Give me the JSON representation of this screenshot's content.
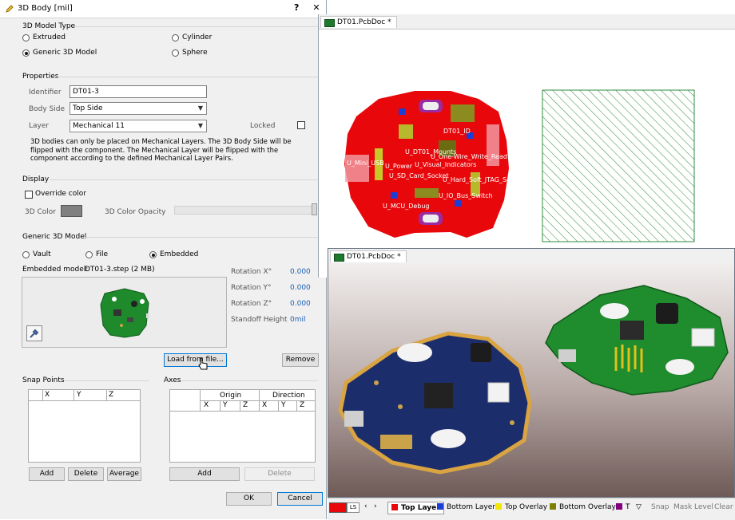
{
  "dialog": {
    "title": "3D Body [mil]",
    "help_label": "?",
    "close_label": "✕",
    "model_type": {
      "heading": "3D Model Type",
      "options": [
        "Extruded",
        "Cylinder",
        "Generic 3D Model",
        "Sphere"
      ],
      "selected": "Generic 3D Model"
    },
    "properties": {
      "heading": "Properties",
      "identifier_label": "Identifier",
      "identifier_value": "DT01-3",
      "body_side_label": "Body Side",
      "body_side_value": "Top Side",
      "layer_label": "Layer",
      "layer_value": "Mechanical 11",
      "locked_label": "Locked",
      "note": "3D bodies can only be placed on Mechanical Layers. The 3D Body Side will be flipped with the component. The Mechanical Layer will be flipped with the component according to the defined Mechanical Layer Pairs."
    },
    "display": {
      "heading": "Display",
      "override_label": "Override color",
      "color_label": "3D Color",
      "color_value": "#808080",
      "opacity_label": "3D Color Opacity"
    },
    "generic": {
      "heading": "Generic 3D Model",
      "source_options": [
        "Vault",
        "File",
        "Embedded"
      ],
      "source_selected": "Embedded",
      "embedded_label": "Embedded model:",
      "embedded_value": "DT01-3.step (2 MB)",
      "rot_x_label": "Rotation X°",
      "rot_x_value": "0.000",
      "rot_y_label": "Rotation Y°",
      "rot_y_value": "0.000",
      "rot_z_label": "Rotation Z°",
      "rot_z_value": "0.000",
      "standoff_label": "Standoff Height",
      "standoff_value": "0mil",
      "load_button": "Load from file...",
      "remove_button": "Remove"
    },
    "snap_points": {
      "heading": "Snap Points",
      "columns": [
        "X",
        "Y",
        "Z"
      ],
      "add_button": "Add",
      "delete_button": "Delete",
      "average_button": "Average"
    },
    "axes": {
      "heading": "Axes",
      "group_origin": "Origin",
      "group_direction": "Direction",
      "columns": [
        "X",
        "Y",
        "Z",
        "X",
        "Y",
        "Z"
      ],
      "add_button": "Add",
      "delete_button": "Delete"
    },
    "ok_button": "OK",
    "cancel_button": "Cancel"
  },
  "pcb2d": {
    "tab_label": "DT01.PcbDoc *",
    "board_color": "#e8080c",
    "hatch_color": "#2e8b3e",
    "labels": [
      "DT01_ID",
      "U_DT01_Mounts",
      "U_One-Wire_Write_Read",
      "U_Mini_USB",
      "U_Power",
      "U_Visual_Indicators",
      "U_SD_Card_Socket",
      "U_Hard_Soft_JTAG_Socket",
      "U_IO_Bus_Switch",
      "U_MCU_Debug"
    ]
  },
  "pcb3d": {
    "tab_label": "DT01.PcbDoc *"
  },
  "status_bar": {
    "current_color": "#e8080c",
    "ls_label": "LS",
    "layers": [
      {
        "name": "Top Layer",
        "color": "#e8080c"
      },
      {
        "name": "Bottom Layer",
        "color": "#1b3fd6"
      },
      {
        "name": "Top Overlay",
        "color": "#f2e600"
      },
      {
        "name": "Bottom Overlay",
        "color": "#808000"
      },
      {
        "name": "T",
        "color": "#800080"
      }
    ],
    "snap": "Snap",
    "mask_level": "Mask Level",
    "clear": "Clear"
  }
}
